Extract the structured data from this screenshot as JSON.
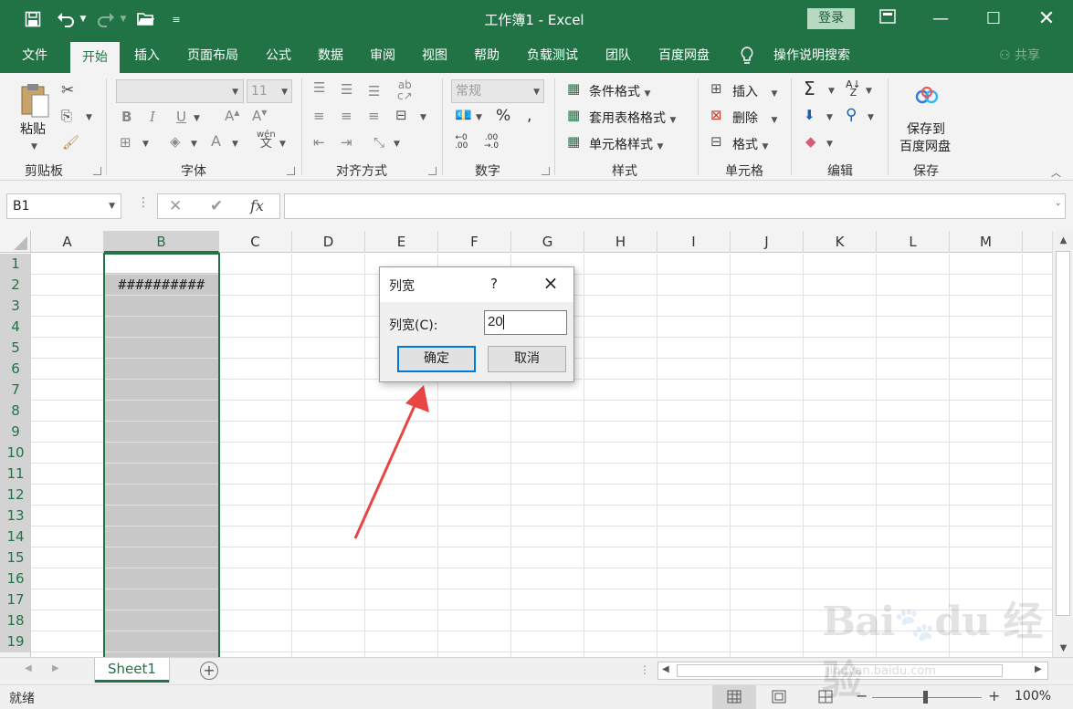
{
  "window": {
    "title": "工作簿1 - Excel",
    "login_label": "登录",
    "share_label": "共享",
    "quick_access": [
      "save-icon",
      "undo-icon",
      "redo-icon",
      "open-folder-icon",
      "customize-icon"
    ],
    "controls": [
      "ribbon-display-icon",
      "minimize-icon",
      "maximize-icon",
      "close-icon"
    ]
  },
  "menu": {
    "tabs": [
      "文件",
      "开始",
      "插入",
      "页面布局",
      "公式",
      "数据",
      "审阅",
      "视图",
      "帮助",
      "负载测试",
      "团队",
      "百度网盘"
    ],
    "active": "开始",
    "tell_me": "操作说明搜索"
  },
  "ribbon": {
    "clipboard": {
      "paste": "粘贴",
      "label": "剪贴板"
    },
    "font": {
      "name": "",
      "size": "11",
      "label": "字体",
      "phonetic": "wén"
    },
    "alignment": {
      "label": "对齐方式"
    },
    "number": {
      "format": "常规",
      "label": "数字"
    },
    "styles": {
      "conditional": "条件格式",
      "table": "套用表格格式",
      "cell": "单元格样式",
      "label": "样式"
    },
    "cells": {
      "insert": "插入",
      "delete": "删除",
      "format": "格式",
      "label": "单元格"
    },
    "editing": {
      "label": "编辑"
    },
    "save": {
      "line1": "保存到",
      "line2": "百度网盘",
      "label": "保存"
    }
  },
  "formula_bar": {
    "name_box": "B1",
    "fx": "fx",
    "formula": ""
  },
  "grid": {
    "columns": [
      "A",
      "B",
      "C",
      "D",
      "E",
      "F",
      "G",
      "H",
      "I",
      "J",
      "K",
      "L",
      "M"
    ],
    "selected_column": "B",
    "rows": [
      "1",
      "2",
      "3",
      "4",
      "5",
      "6",
      "7",
      "8",
      "9",
      "10",
      "11",
      "12",
      "13",
      "14",
      "15",
      "16",
      "17",
      "18",
      "19"
    ],
    "cell_B2": "##########"
  },
  "dialog": {
    "title": "列宽",
    "help": "?",
    "field_label": "列宽(C):",
    "value": "20",
    "ok": "确定",
    "cancel": "取消"
  },
  "sheets": {
    "tabs": [
      "Sheet1"
    ]
  },
  "status": {
    "text": "就绪",
    "zoom": "100%"
  },
  "watermark": {
    "text": "Bai du 经验",
    "sub": "jingyan.baidu.com"
  },
  "colors": {
    "accent": "#217346",
    "arrow": "#e84545",
    "selection": "#c8c8c8"
  }
}
